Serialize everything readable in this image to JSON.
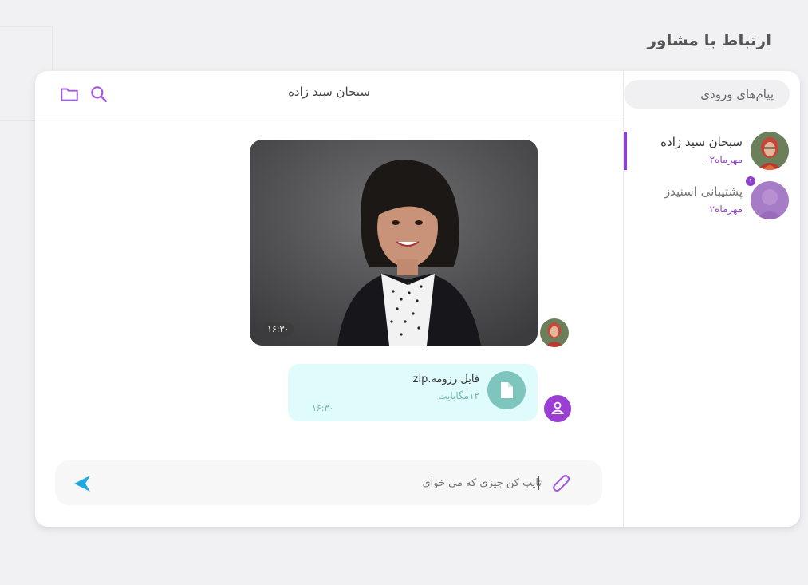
{
  "page": {
    "title": "ارتباط با مشاور"
  },
  "sidebar": {
    "tab_label": "پیام‌های ورودی",
    "contacts": [
      {
        "name": "سبحان سید زاده",
        "date": "مهرماه۲ -",
        "active": true
      },
      {
        "name": "پشتیبانی اسنیدز",
        "date": "مهرماه۲",
        "unread": "۱"
      }
    ]
  },
  "chat": {
    "title": "سبحان سید زاده",
    "image_message": {
      "time": "۱۶:۳۰"
    },
    "file_message": {
      "name": "فایل رزومه.zip",
      "size": "۱۲مگابایت",
      "time": "۱۶:۳۰"
    },
    "composer": {
      "placeholder": "تایپ کن چیزی که می خوای"
    }
  },
  "colors": {
    "accent": "#8e3fd0",
    "send": "#1fa8e0",
    "file_bubble": "#e0fbfb",
    "file_icon": "#7dc5bd"
  },
  "icons": [
    "folder-icon",
    "search-icon",
    "paperclip-icon",
    "send-icon",
    "file-icon",
    "user-icon"
  ]
}
